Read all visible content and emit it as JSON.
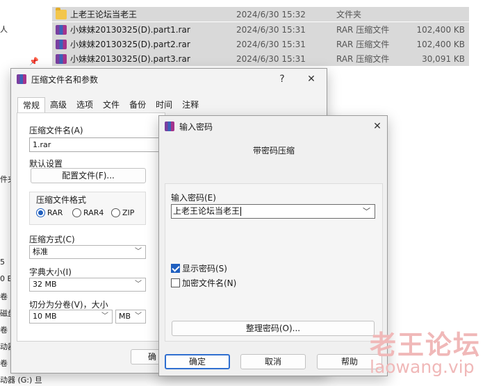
{
  "explorer": {
    "nav_fragments": [
      "人",
      "件夹",
      "5",
      "0 E",
      "卷 (",
      "磁盘",
      "卷 (",
      "动器",
      "卷 (H",
      "动器 (G:) 旦"
    ],
    "files": [
      {
        "name": "上老王论坛当老王",
        "date": "2024/6/30 15:32",
        "type": "文件夹",
        "size": "",
        "icon": "folder-icon"
      },
      {
        "name": "小妹妹20130325(D).part1.rar",
        "date": "2024/6/30 15:31",
        "type": "RAR 压缩文件",
        "size": "102,400 KB",
        "icon": "rar-file-icon"
      },
      {
        "name": "小妹妹20130325(D).part2.rar",
        "date": "2024/6/30 15:31",
        "type": "RAR 压缩文件",
        "size": "102,400 KB",
        "icon": "rar-file-icon"
      },
      {
        "name": "小妹妹20130325(D).part3.rar",
        "date": "2024/6/30 15:31",
        "type": "RAR 压缩文件",
        "size": "30,091 KB",
        "icon": "rar-file-icon"
      }
    ]
  },
  "archive_dialog": {
    "title": "压缩文件名和参数",
    "help": "?",
    "close": "✕",
    "tabs": [
      "常规",
      "高级",
      "选项",
      "文件",
      "备份",
      "时间",
      "注释"
    ],
    "archive_name_label": "压缩文件名(A)",
    "archive_name_value": "1.rar",
    "default_settings_label": "默认设置",
    "profile_button": "配置文件(F)...",
    "format_group_label": "压缩文件格式",
    "formats": [
      "RAR",
      "RAR4",
      "ZIP"
    ],
    "selected_format": "RAR",
    "method_label": "压缩方式(C)",
    "method_value": "标准",
    "dict_label": "字典大小(I)",
    "dict_value": "32 MB",
    "split_label": "切分为分卷(V)，大小",
    "split_value": "10 MB",
    "split_unit": "MB",
    "ok_button_partial": "确"
  },
  "password_dialog": {
    "title": "输入密码",
    "close": "✕",
    "heading": "带密码压缩",
    "password_label": "输入密码(E)",
    "password_value": "上老王论坛当老王",
    "show_password_label": "显示密码(S)",
    "show_password_checked": true,
    "encrypt_names_label": "加密文件名(N)",
    "encrypt_names_checked": false,
    "organize_button": "整理密码(O)...",
    "ok_button": "确定",
    "cancel_button": "取消",
    "help_button": "帮助"
  },
  "watermark": {
    "title": "老王论坛",
    "url": "laowang.vip"
  },
  "colors": {
    "selection": "#d9d9d9",
    "accent": "#1f5fbf",
    "watermark": "#f0b8b8"
  }
}
